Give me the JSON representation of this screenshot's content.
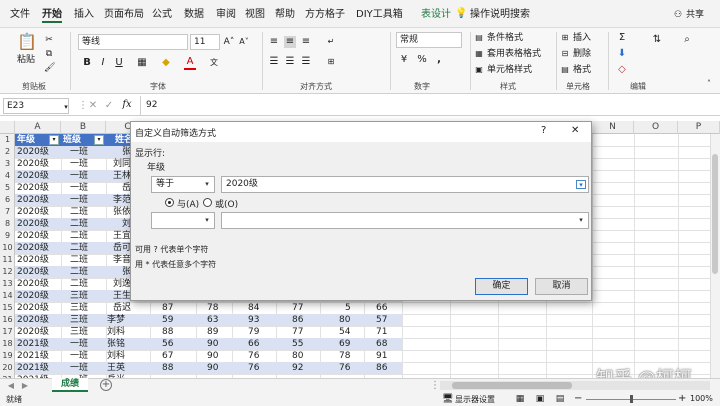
{
  "menu": {
    "tabs": [
      "文件",
      "开始",
      "插入",
      "页面布局",
      "公式",
      "数据",
      "审阅",
      "视图",
      "帮助",
      "方方格子",
      "DIY工具箱",
      "表设计"
    ],
    "active_tab": "开始",
    "search": "操作说明搜索",
    "share": "共享"
  },
  "ribbon": {
    "paste": "粘贴",
    "groups": {
      "clipboard": "剪贴板",
      "font": "字体",
      "align": "对齐方式",
      "number": "数字",
      "styles": "样式",
      "cells": "单元格",
      "editing": "编辑"
    },
    "font_name": "等线",
    "font_size": "11",
    "number_format": "常规",
    "cond_format": "条件格式",
    "table_format": "套用表格格式",
    "cell_style": "单元格样式",
    "insert": "插入",
    "delete": "删除",
    "format": "格式"
  },
  "formula_bar": {
    "name_box": "E23",
    "fx": "fx",
    "value": "92"
  },
  "columns": [
    "A",
    "B",
    "C",
    "D",
    "E",
    "F",
    "G",
    "H",
    "I",
    "J",
    "K",
    "L",
    "M",
    "N",
    "O",
    "P"
  ],
  "rows": [
    "1",
    "2",
    "3",
    "4",
    "5",
    "6",
    "7",
    "8",
    "9",
    "10",
    "11",
    "12",
    "13",
    "14",
    "15",
    "16",
    "17",
    "18",
    "19",
    "20",
    "21"
  ],
  "table": {
    "header": [
      "年级",
      "班级",
      "姓名"
    ],
    "grade": [
      "2020级",
      "2020级",
      "2020级",
      "2020级",
      "2020级",
      "2020级",
      "2020级",
      "2020级",
      "2020级",
      "2020级",
      "2020级",
      "2020级",
      "2020级",
      "2020级",
      "2020级",
      "2020级",
      "2021级",
      "2021级",
      "2021级",
      "2021级"
    ],
    "class": [
      "一班",
      "一班",
      "一班",
      "一班",
      "一班",
      "二班",
      "二班",
      "二班",
      "二班",
      "二班",
      "二班",
      "二班",
      "三班",
      "三班",
      "三班",
      "三班",
      "一班",
      "一班",
      "一班",
      "一班"
    ],
    "name": [
      "张",
      "刘同",
      "王林",
      "岳",
      "李范",
      "张依",
      "刘",
      "王宜",
      "岳可",
      "李音",
      "张",
      "刘逸",
      "王生",
      "岳迟",
      "李梦",
      "刘科",
      "张铭",
      "刘科",
      "王英",
      "岳光"
    ],
    "extra_rows": [
      [
        "87",
        "78",
        "84",
        "77",
        "5",
        "66"
      ],
      [
        "59",
        "63",
        "93",
        "86",
        "80",
        "57"
      ],
      [
        "88",
        "89",
        "79",
        "77",
        "54",
        "71"
      ],
      [
        "56",
        "90",
        "66",
        "55",
        "69",
        "68"
      ],
      [
        "67",
        "90",
        "76",
        "80",
        "78",
        "91"
      ],
      [
        "88",
        "90",
        "76",
        "92",
        "76",
        "86"
      ]
    ]
  },
  "dialog": {
    "title": "自定义自动筛选方式",
    "help": "?",
    "close": "✕",
    "show_rows": "显示行:",
    "field": "年级",
    "op1": "等于",
    "val1": "2020级",
    "and": "与(A)",
    "or": "或(O)",
    "op2": "",
    "val2": "",
    "hint1": "可用 ? 代表单个字符",
    "hint2": "用 * 代表任意多个字符",
    "ok": "确定",
    "cancel": "取消"
  },
  "sheet": {
    "tab": "成绩",
    "add": "+"
  },
  "status": {
    "ready": "就绪",
    "display": "显示器设置",
    "zoom": "100%"
  },
  "watermark": "知乎 @柯柯",
  "colors": {
    "header_blue": "#4472c4",
    "band_light": "#d9e1f2",
    "accent_green": "#1e7a45"
  }
}
